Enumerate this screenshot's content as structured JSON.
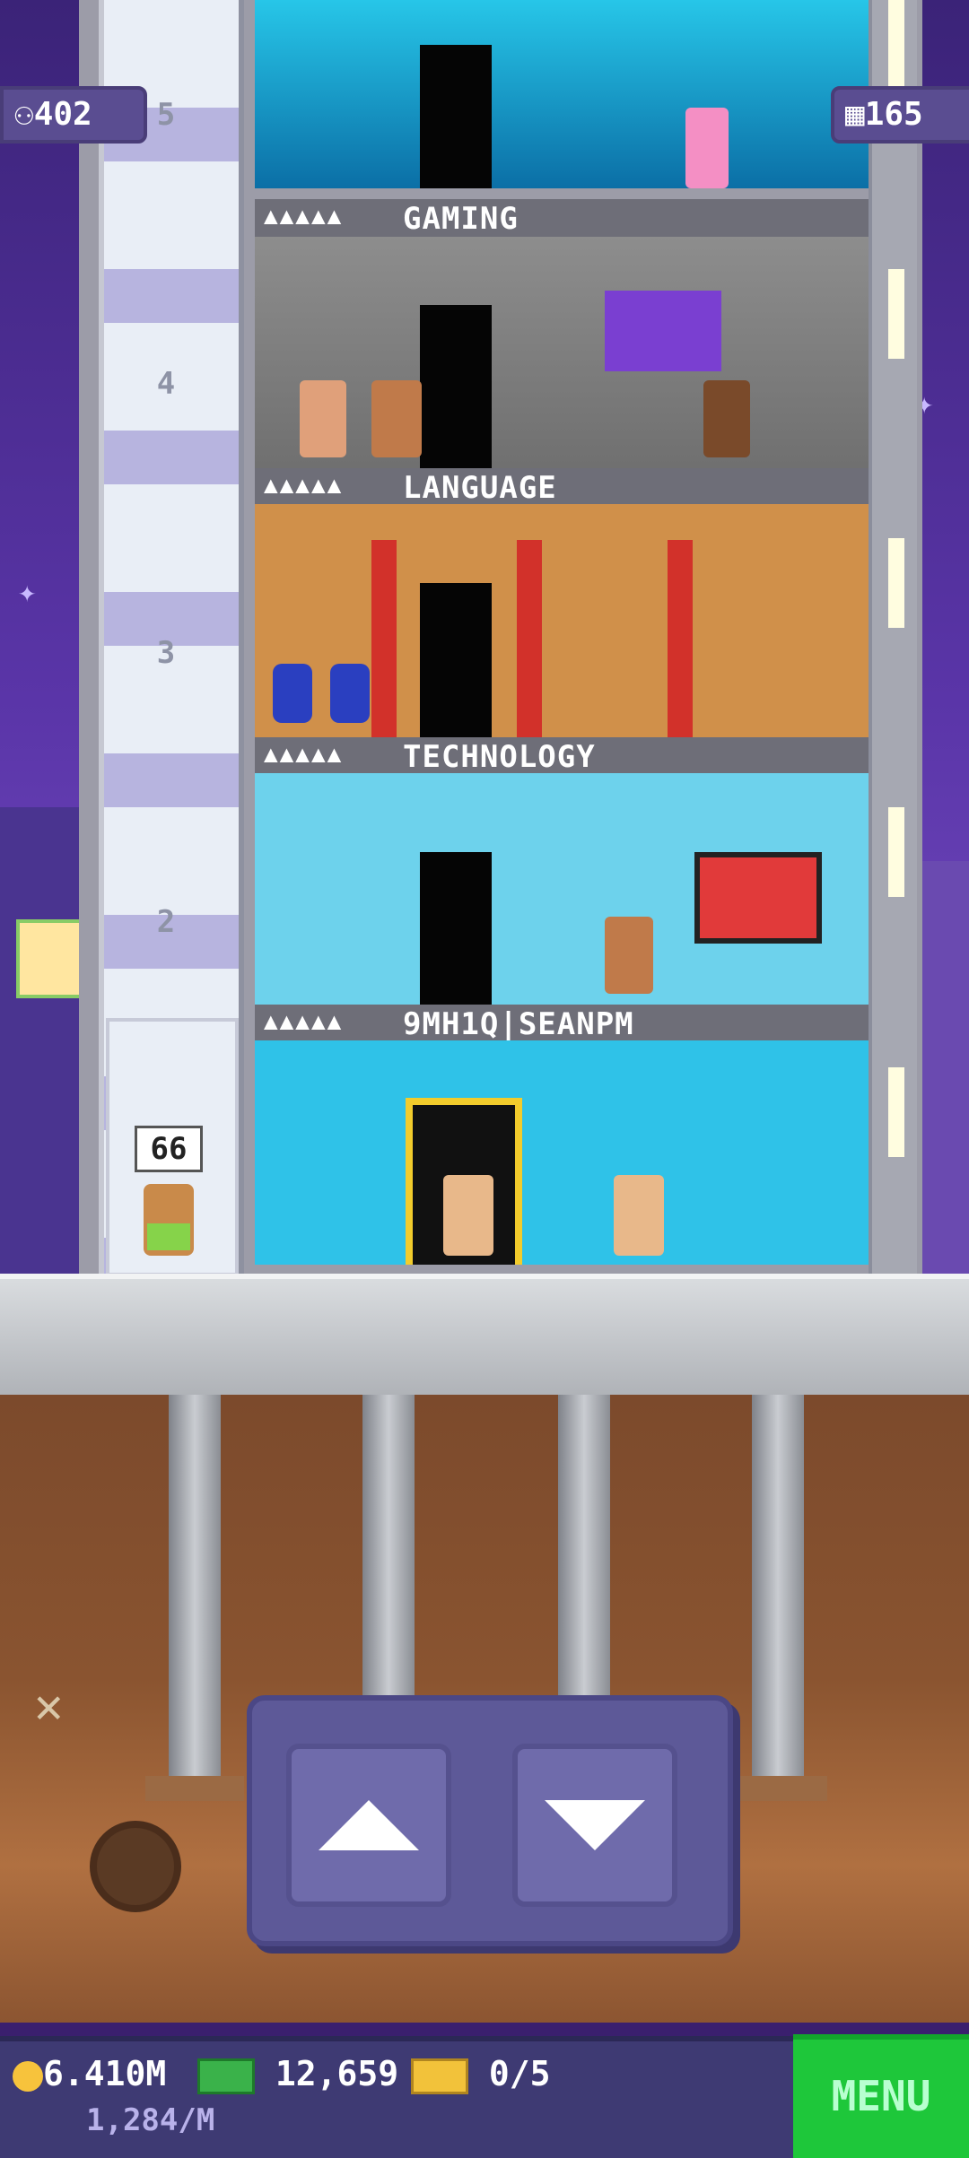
{
  "hud": {
    "population": "402",
    "floors": "165"
  },
  "elevator": {
    "floor_labels": [
      "5",
      "4",
      "3",
      "2"
    ],
    "rider_destination": "66"
  },
  "floors": [
    {
      "id": "gaming",
      "name": "GAMING",
      "occupancy": "▲▲▲▲▲"
    },
    {
      "id": "language",
      "name": "LANGUAGE",
      "occupancy": "▲▲▲▲▲"
    },
    {
      "id": "technology",
      "name": "TECHNOLOGY",
      "occupancy": "▲▲▲▲▲"
    },
    {
      "id": "lobby",
      "name": "9MH1Q|SEANPM",
      "occupancy": "▲▲▲▲▲"
    }
  ],
  "currency": {
    "coins": "6.410M",
    "coins_rate": "1,284/M",
    "bux": "12,659",
    "tickets": "0/5"
  },
  "menu_label": "MENU",
  "icons": {
    "population": "person-icon",
    "floors": "building-icon",
    "coin": "coin-icon",
    "bux": "bux-icon",
    "ticket": "ticket-icon"
  }
}
